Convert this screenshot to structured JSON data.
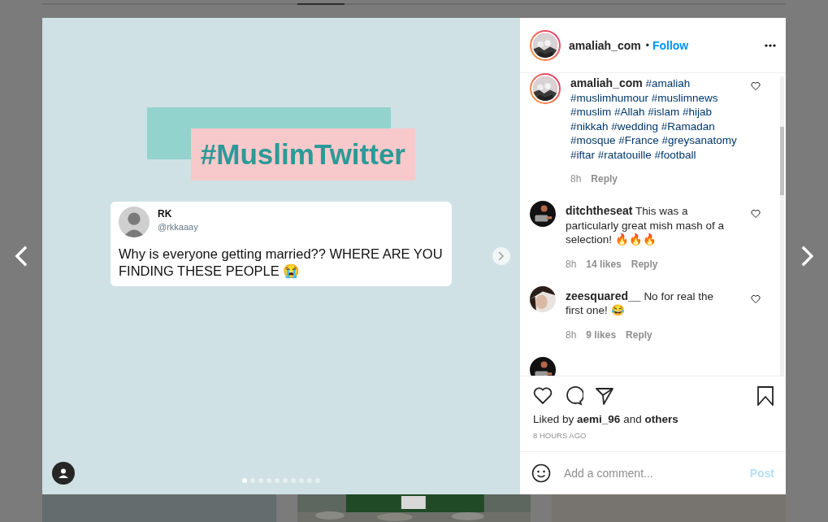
{
  "post": {
    "headline": "#MuslimTwitter",
    "tweet": {
      "name": "RK",
      "handle": "@rkkaaay",
      "text": "Why is everyone getting married?? WHERE ARE YOU FINDING THESE PEOPLE 😭"
    },
    "dots": [
      {
        "selected": true
      },
      {
        "selected": false
      },
      {
        "selected": false
      },
      {
        "selected": false
      },
      {
        "selected": false
      },
      {
        "selected": false
      },
      {
        "selected": false
      },
      {
        "selected": false
      },
      {
        "selected": false
      },
      {
        "selected": false
      }
    ]
  },
  "header": {
    "user": "amaliah_com",
    "separator": "•",
    "follow": "Follow"
  },
  "comments": [
    {
      "kind": "caption",
      "user": "amaliah_com",
      "text": "#amaliah #muslimhumour #muslimnews #muslim #Allah #islam #hijab #nikkah #wedding #Ramadan #mosque #France #greysanatomy #iftar #ratatouille #football",
      "time": "8h",
      "reply": "Reply"
    },
    {
      "kind": "comment",
      "user": "ditchtheseat",
      "text": "This was a particularly great mish mash of a selection! 🔥🔥🔥",
      "time": "8h",
      "likes": "14 likes",
      "reply": "Reply"
    },
    {
      "kind": "comment",
      "user": "zeesquared__",
      "text": "No for real the first one! 😂",
      "time": "8h",
      "likes": "9 likes",
      "reply": "Reply"
    }
  ],
  "likes": {
    "prefix": "Liked by",
    "user": "aemi_96",
    "joiner": "and",
    "others": "others"
  },
  "timestamp": "8 HOURS AGO",
  "add_comment": {
    "placeholder": "Add a comment...",
    "post": "Post"
  }
}
